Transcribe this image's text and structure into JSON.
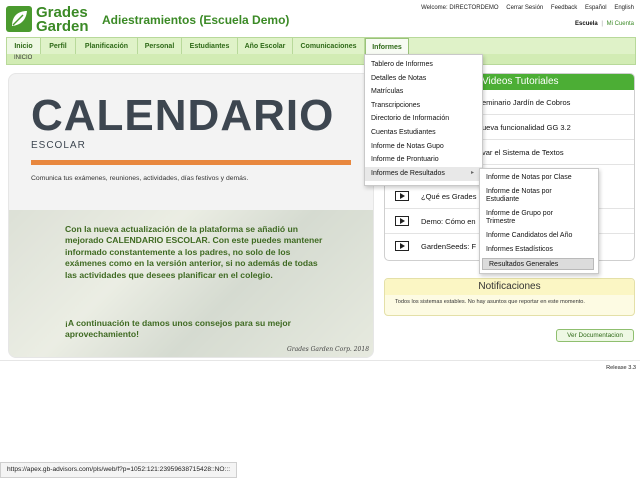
{
  "header": {
    "logo": {
      "line1": "Grades",
      "line2": "Garden"
    },
    "app_title": "Adiestramientos (Escuela Demo)",
    "welcome": "Welcome: DIRECTORDEMO",
    "logout": "Cerrar Sesión",
    "feedback": "Feedback",
    "lang_es": "Español",
    "lang_en": "English",
    "school": "Escuela",
    "school_sep": "|",
    "account": "Mi Cuenta"
  },
  "nav": {
    "tabs": [
      {
        "label": "Inicio"
      },
      {
        "label": "Perfil"
      },
      {
        "label": "Planificación"
      },
      {
        "label": "Personal"
      },
      {
        "label": "Estudiantes"
      },
      {
        "label": "Año Escolar"
      },
      {
        "label": "Comunicaciones"
      },
      {
        "label": "Informes"
      }
    ],
    "breadcrumb": "INICIO"
  },
  "reports_menu": {
    "items": [
      {
        "label": "Tablero de Informes"
      },
      {
        "label": "Detalles de Notas"
      },
      {
        "label": "Matrículas"
      },
      {
        "label": "Transcripciones"
      },
      {
        "label": "Directorio de Información"
      },
      {
        "label": "Cuentas Estudiantes"
      },
      {
        "label": "Informe de Notas Gupo"
      },
      {
        "label": "Informe de Prontuario"
      },
      {
        "label": "Informes de Resultados",
        "arrow": "▸"
      }
    ]
  },
  "results_submenu": {
    "items": [
      {
        "label": "Informe de Notas por Clase"
      },
      {
        "label": "Informe de Notas por Estudiante"
      },
      {
        "label": "Informe de Grupo por Trimestre"
      },
      {
        "label": "Informe Candidatos del Año"
      },
      {
        "label": "Informes Estadísticos"
      },
      {
        "label": "Resultados Generales"
      }
    ]
  },
  "calendar": {
    "title": "CALENDARIO",
    "subtitle": "ESCOLAR",
    "note": "Comunica tus exámenes, reuniones, actividades, días festivos y demás.",
    "body": "Con la nueva actualización de la plataforma se añadió un mejorado CALENDARIO ESCOLAR. Con este puedes mantener informado constantemente a los padres, no solo de los exámenes como en la versión anterior, si no además de todas las actividades que desees planificar en el colegio.",
    "body2": "¡A continuación te damos unos consejos para su mejor aprovechamiento!",
    "credit": "Grades Garden Corp. 2018",
    "accent": "#e8873e"
  },
  "videos": {
    "title": "Videos Tutoriales",
    "items": [
      {
        "label": "eminario Jardín de Cobros"
      },
      {
        "label": "ueva funcionalidad GG 3.2"
      },
      {
        "label": "var el Sistema de Textos"
      },
      {
        "label": "¿Qué es Grades"
      },
      {
        "label": "Demo: Cómo en"
      },
      {
        "label": "GardenSeeds: F"
      }
    ]
  },
  "notifications": {
    "title": "Notificaciones",
    "body": "Todos los sistemas estables. No hay asuntos que reportar en este momento."
  },
  "doc_button": "Ver Documentacion",
  "release": "Release 3.3",
  "status_url": "https://apex.gb-advisors.com/pls/web/f?p=1052:121:23959638715428::NO:::",
  "colors": {
    "brand": "#3b8a26",
    "header_green": "#4cae35"
  }
}
